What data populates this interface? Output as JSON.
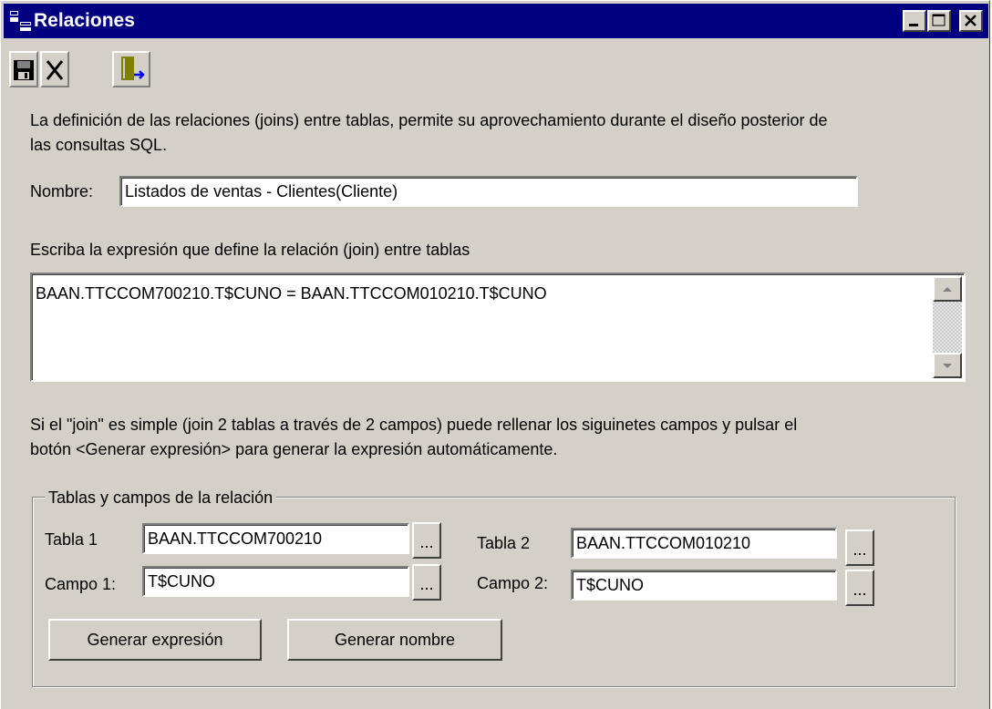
{
  "window": {
    "title": "Relaciones"
  },
  "toolbar": {
    "icons": [
      "save-icon",
      "delete-x-icon",
      "exit-door-icon"
    ]
  },
  "description": {
    "line1": "La definición de las relaciones (joins) entre tablas, permite su aprovechamiento durante el diseño posterior de",
    "line2": "las consultas SQL."
  },
  "name_field": {
    "label": "Nombre:",
    "value": "Listados de ventas - Clientes(Cliente)"
  },
  "expression": {
    "label": "Escriba la expresión que define la relación (join) entre tablas",
    "value": "BAAN.TTCCOM700210.T$CUNO = BAAN.TTCCOM010210.T$CUNO"
  },
  "hint": {
    "line1": "Si el \"join\" es simple (join 2 tablas a través de 2 campos) puede rellenar los siguinetes campos y pulsar el",
    "line2": "botón <Generar expresión> para generar la expresión automáticamente."
  },
  "group": {
    "legend": "Tablas y campos de la relación",
    "tabla1": {
      "label": "Tabla 1",
      "value": "BAAN.TTCCOM700210"
    },
    "campo1": {
      "label": "Campo 1:",
      "value": "T$CUNO"
    },
    "tabla2": {
      "label": "Tabla 2",
      "value": "BAAN.TTCCOM010210"
    },
    "campo2": {
      "label": "Campo 2:",
      "value": "T$CUNO"
    },
    "browse_label": "...",
    "gen_expr_label": "Generar expresión",
    "gen_name_label": "Generar nombre"
  }
}
